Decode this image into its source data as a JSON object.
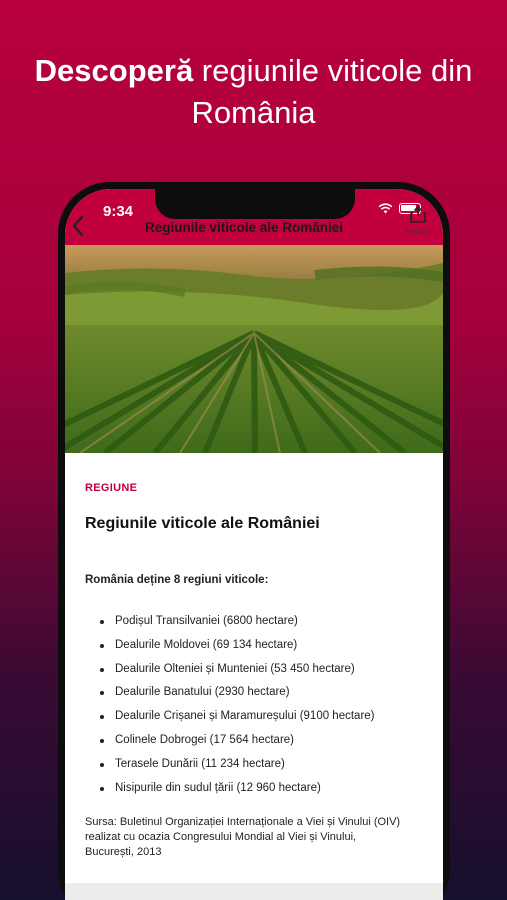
{
  "promo": {
    "headline_bold": "Descoperă",
    "headline_rest": " regiunile viticole din România"
  },
  "status_bar": {
    "time": "9:34"
  },
  "nav": {
    "title": "Regiunile viticole ale României",
    "share_label": "SHARE"
  },
  "article": {
    "tag": "REGIUNE",
    "title": "Regiunile viticole ale României",
    "intro": "România deține 8 regiuni viticole:",
    "regions": [
      "Podișul Transilvaniei (6800 hectare)",
      "Dealurile Moldovei (69 134 hectare)",
      "Dealurile Olteniei și Munteniei (53 450 hectare)",
      "Dealurile Banatului (2930 hectare)",
      "Dealurile Crișanei și Maramureșului (9100 hectare)",
      "Colinele Dobrogei (17 564 hectare)",
      "Terasele Dunării (11 234 hectare)",
      "Nisipurile din sudul țării (12 960 hectare)"
    ],
    "source": "Sursa: Buletinul Organizației Internaționale a Viei și Vinului (OIV) realizat cu ocazia Congresului Mondial al Viei și Vinului, București, 2013"
  },
  "colors": {
    "brand": "#c2003e",
    "background_top": "#b8003f",
    "background_bottom": "#15102c"
  },
  "icons": {
    "back": "chevron-left-icon",
    "share": "share-icon",
    "wifi": "wifi-icon",
    "battery": "battery-icon"
  }
}
